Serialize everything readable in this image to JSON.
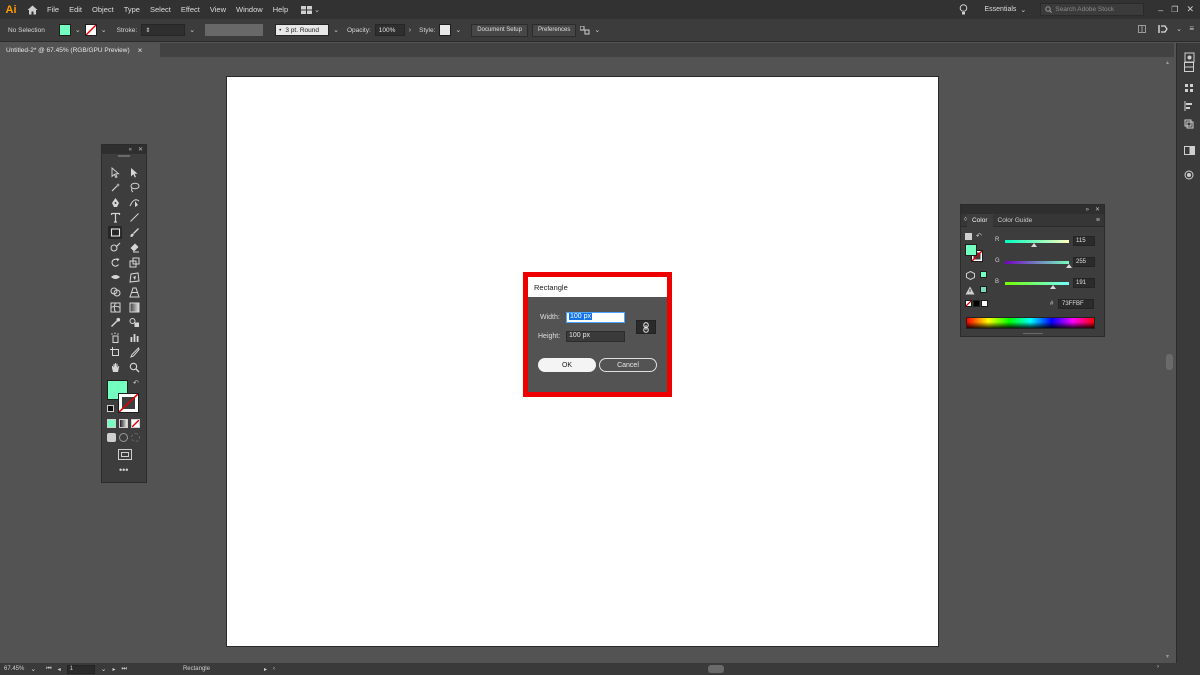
{
  "app": {
    "logo": "Ai",
    "menu": [
      "File",
      "Edit",
      "Object",
      "Type",
      "Select",
      "Effect",
      "View",
      "Window",
      "Help"
    ],
    "workspace": "Essentials",
    "search_placeholder": "Search Adobe Stock"
  },
  "control_bar": {
    "selection": "No Selection",
    "fill_color": "#73FFBF",
    "stroke_label": "Stroke:",
    "brush": "3 pt. Round",
    "opacity_label": "Opacity:",
    "opacity": "100%",
    "style_label": "Style:",
    "document_setup": "Document Setup",
    "preferences": "Preferences"
  },
  "document": {
    "tab_title": "Untitled-2* @ 67.45% (RGB/GPU Preview)",
    "close_glyph": "×"
  },
  "dialog": {
    "title": "Rectangle",
    "width_label": "Width:",
    "width_value": "100 px",
    "height_label": "Height:",
    "height_value": "100 px",
    "ok": "OK",
    "cancel": "Cancel",
    "highlight_color": "#EE0000"
  },
  "color_panel": {
    "tabs": [
      "Color",
      "Color Guide"
    ],
    "channels": [
      {
        "letter": "R",
        "value": "115",
        "level": 0.451
      },
      {
        "letter": "G",
        "value": "255",
        "level": 1.0
      },
      {
        "letter": "B",
        "value": "191",
        "level": 0.749
      }
    ],
    "hex_label": "#",
    "hex": "73FFBF",
    "fill_color": "#73FFBF"
  },
  "status": {
    "zoom": "67.45%",
    "artboard_number": "1",
    "current_tool": "Rectangle"
  }
}
